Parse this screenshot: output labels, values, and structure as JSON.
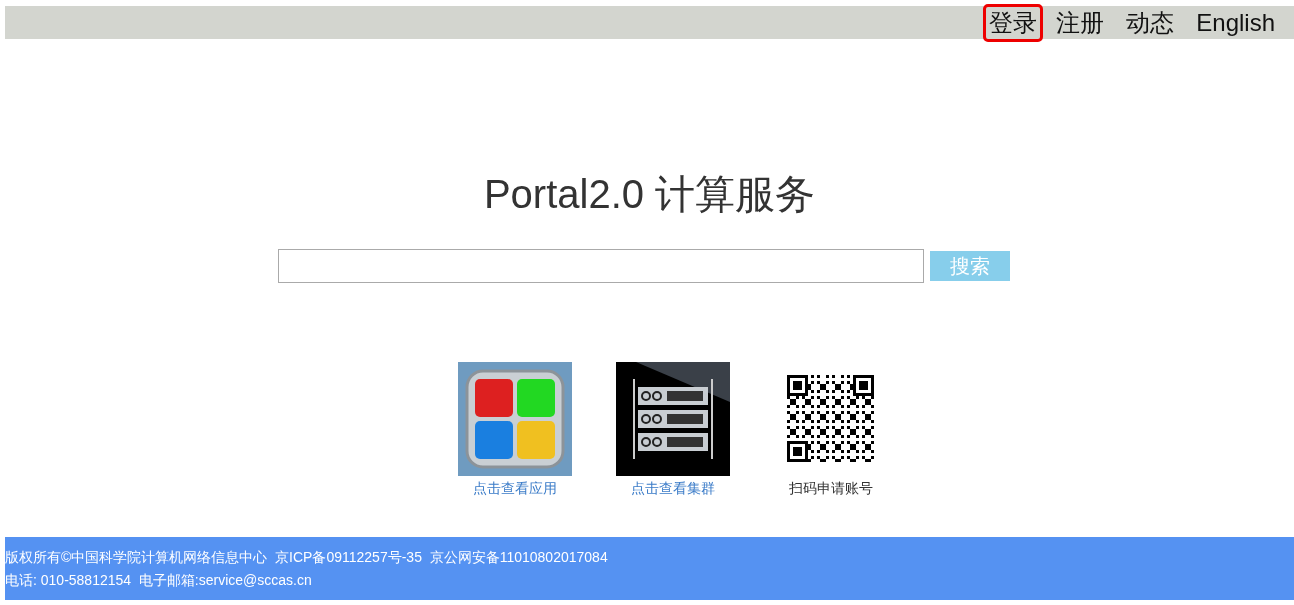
{
  "nav": [
    {
      "label": "登录",
      "highlighted": true
    },
    {
      "label": "注册",
      "highlighted": false
    },
    {
      "label": "动态",
      "highlighted": false
    },
    {
      "label": "English",
      "highlighted": false
    }
  ],
  "title": "Portal2.0 计算服务",
  "search": {
    "button": "搜索"
  },
  "tiles": [
    {
      "kind": "apps",
      "label": "点击查看应用",
      "link": true
    },
    {
      "kind": "cluster",
      "label": "点击查看集群",
      "link": true
    },
    {
      "kind": "qr",
      "label": "扫码申请账号",
      "link": false
    }
  ],
  "footer": [
    "版权所有©中国科学院计算机网络信息中心  京ICP备09112257号-35  京公网安备11010802017084",
    "电话: 010-58812154  电子邮箱:service@sccas.cn"
  ]
}
